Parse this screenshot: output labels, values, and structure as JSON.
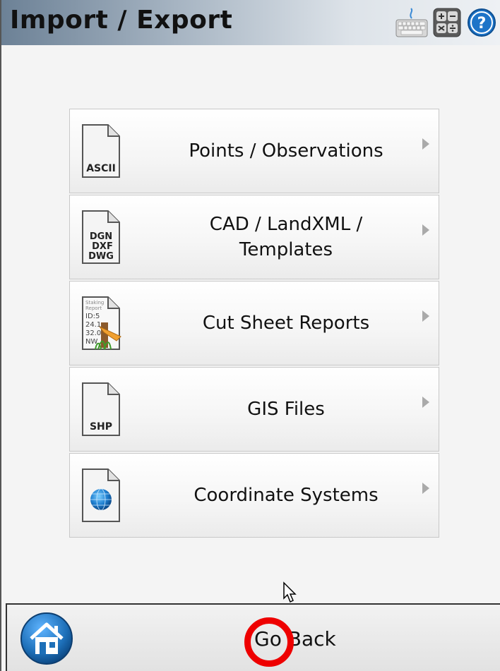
{
  "header": {
    "title": "Import / Export"
  },
  "toolbar": {
    "icons": [
      "keyboard-icon",
      "calculator-icon",
      "help-icon"
    ]
  },
  "menu": {
    "items": [
      {
        "label": "Points / Observations",
        "icon": "ascii-file-icon",
        "icon_text": "ASCII"
      },
      {
        "label": "CAD / LandXML /\nTemplates",
        "icon": "cad-file-icon",
        "icon_text_1": "DGN",
        "icon_text_2": "DXF",
        "icon_text_3": "DWG"
      },
      {
        "label": "Cut Sheet Reports",
        "icon": "report-file-icon",
        "icon_text_1": "Staking",
        "icon_text_2": "Report",
        "icon_text_3": "ID:5",
        "icon_text_4": "24.1",
        "icon_text_5": "32.0",
        "icon_text_6": "NW"
      },
      {
        "label": "GIS Files",
        "icon": "shp-file-icon",
        "icon_text": "SHP"
      },
      {
        "label": "Coordinate Systems",
        "icon": "globe-file-icon"
      }
    ]
  },
  "footer": {
    "go_back_label": "Go Back"
  },
  "colors": {
    "highlight_ring": "#ee0000",
    "home_button": "#1d6fb8"
  }
}
